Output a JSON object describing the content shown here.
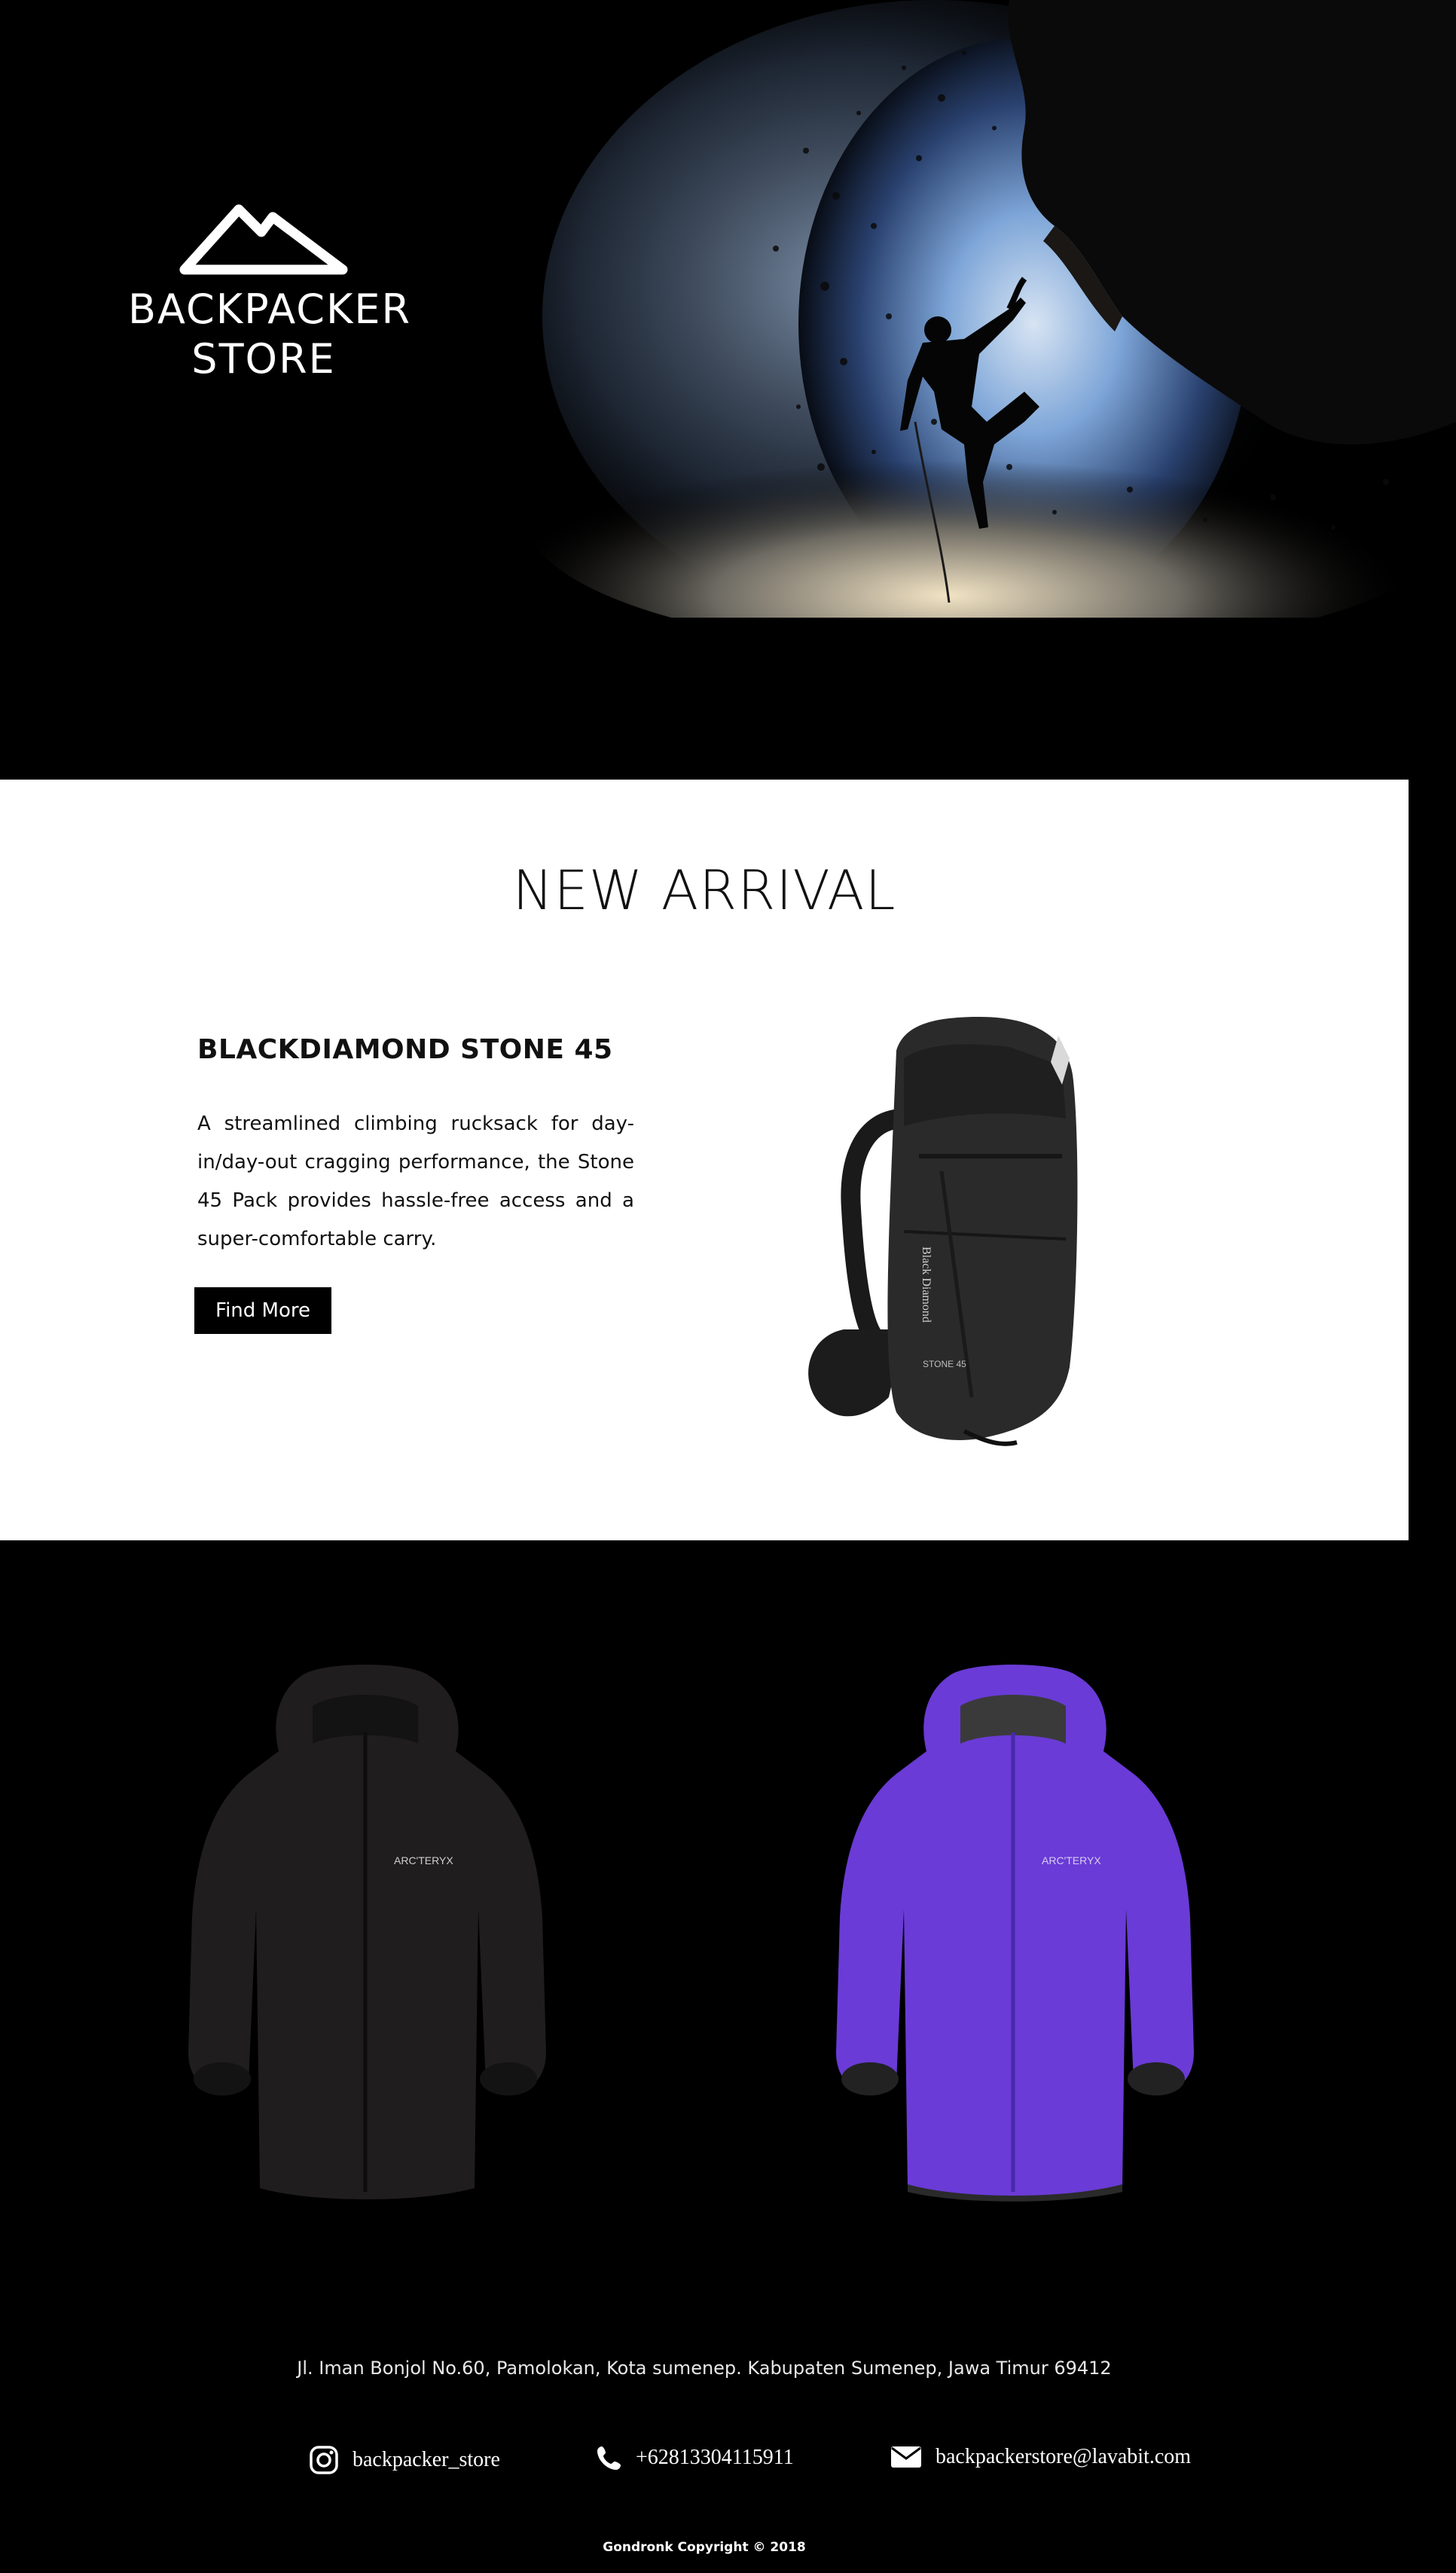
{
  "brand": {
    "name_line1": "BACKPACKER",
    "name_line2": "STORE",
    "logo_icon": "mountain-icon"
  },
  "new_arrival": {
    "title": "NEW ARRIVAL",
    "product_name": "BLACKDIAMOND STONE 45",
    "description": "A streamlined climbing rucksack for day-in/day-out cragging performance, the Stone 45 Pack provides hassle-free access and a super-comfortable carry.",
    "button_label": "Find More",
    "backpack_brand": "Black Diamond",
    "backpack_model": "STONE 45"
  },
  "jackets": [
    {
      "color": "#1f1d1e",
      "brand": "ARC'TERYX"
    },
    {
      "color": "#6a3bd6",
      "brand": "ARC'TERYX"
    }
  ],
  "footer": {
    "address": "Jl. Iman Bonjol No.60, Pamolokan, Kota sumenep. Kabupaten Sumenep, Jawa Timur 69412",
    "instagram": "backpacker_store",
    "phone": "+62813304115911",
    "email": "backpackerstore@lavabit.com",
    "copyright": "Gondronk Copyright © 2018"
  }
}
